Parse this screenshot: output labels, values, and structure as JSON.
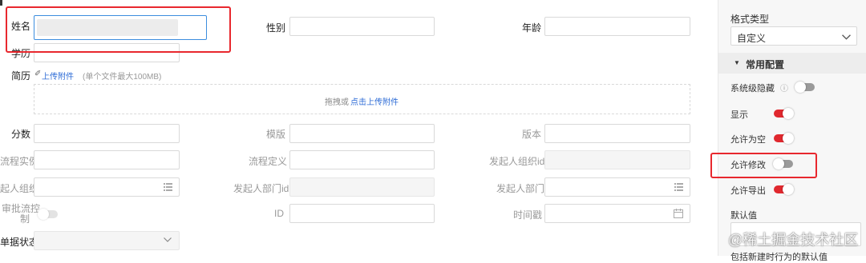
{
  "form": {
    "fields": {
      "name": {
        "label": "姓名"
      },
      "gender": {
        "label": "性别"
      },
      "age": {
        "label": "年龄"
      },
      "education": {
        "label": "学历"
      },
      "resume": {
        "label": "简历",
        "upload_link": "上传附件",
        "upload_hint": "(单个文件最大100MB)",
        "drop_text": "拖拽或",
        "drop_link": "点击上传附件"
      },
      "score": {
        "label": "分数"
      },
      "template": {
        "label": "模版"
      },
      "version": {
        "label": "版本"
      },
      "process_instance": {
        "label": "流程实例"
      },
      "process_definition": {
        "label": "流程定义"
      },
      "initiator_org_id": {
        "label": "发起人组织id"
      },
      "initiator_org": {
        "label": "起人组织"
      },
      "initiator_dept_id": {
        "label": "发起人部门id"
      },
      "initiator_dept": {
        "label": "发起人部门"
      },
      "approval_control": {
        "label_line1": "审批流控",
        "label_line2": "制"
      },
      "id": {
        "label": "ID"
      },
      "timestamp": {
        "label": "时间戳"
      },
      "doc_status": {
        "label": "单据状态"
      }
    }
  },
  "panel": {
    "format_type_label": "格式类型",
    "format_type_value": "自定义",
    "section_title": "常用配置",
    "settings": [
      {
        "label": "系统级隐藏",
        "state": "off"
      },
      {
        "label": "显示",
        "state": "on"
      },
      {
        "label": "允许为空",
        "state": "on"
      },
      {
        "label": "允许修改",
        "state": "off"
      },
      {
        "label": "允许导出",
        "state": "on"
      }
    ],
    "default_value_label": "默认值",
    "cut_label": "包括新建时行为的默认值"
  },
  "watermark": "@稀土掘金技术社区",
  "colors": {
    "accent_red": "#e8282e",
    "link_blue": "#2c6bd6",
    "focus_blue": "#3c8dde"
  }
}
